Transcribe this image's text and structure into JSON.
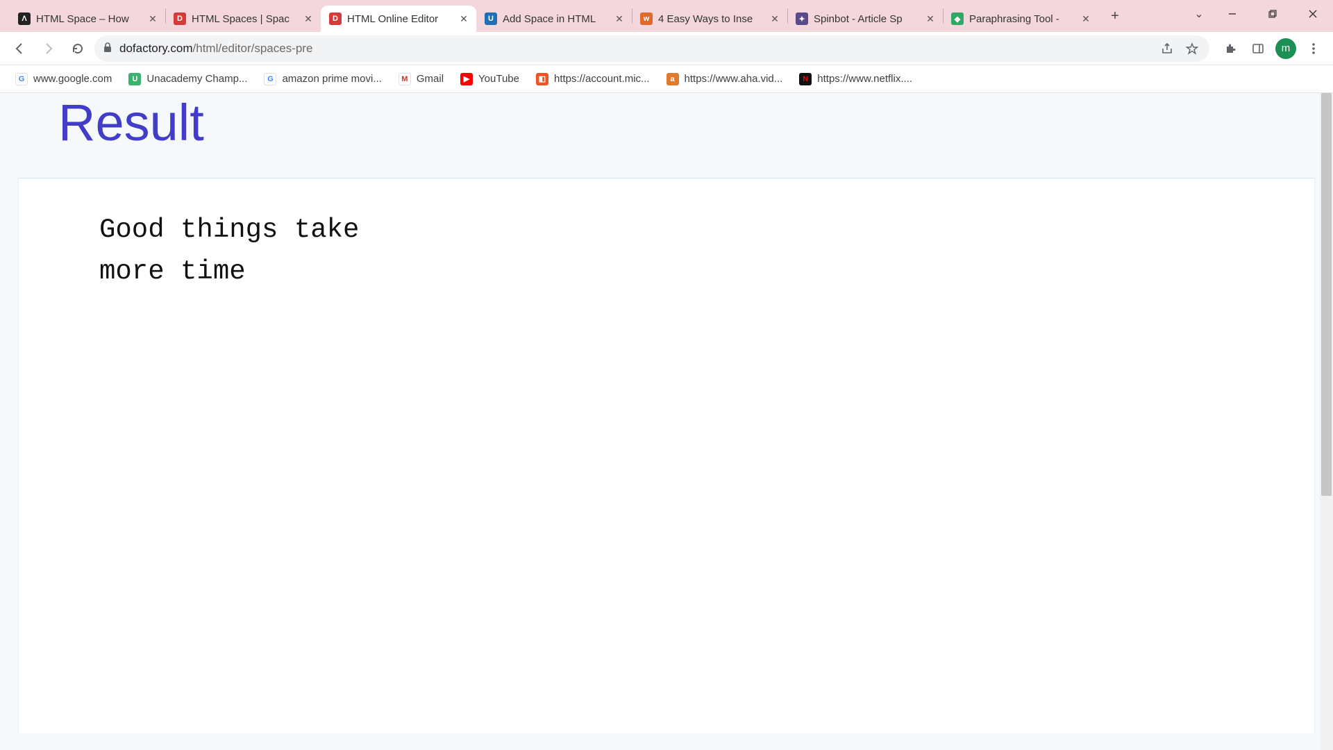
{
  "window": {
    "chevron": "⌄",
    "minimize": "—",
    "maximize": "❐",
    "close": "✕"
  },
  "tabs": [
    {
      "label": "HTML Space – How",
      "fav_bg": "#222222",
      "fav_text": "Λ"
    },
    {
      "label": "HTML Spaces | Spac",
      "fav_bg": "#d63b3b",
      "fav_text": "D"
    },
    {
      "label": "HTML Online Editor",
      "fav_bg": "#d63b3b",
      "fav_text": "D",
      "active": true
    },
    {
      "label": "Add Space in HTML",
      "fav_bg": "#1f6fb2",
      "fav_text": "U"
    },
    {
      "label": "4 Easy Ways to Inse",
      "fav_bg": "#e06a2b",
      "fav_text": "w"
    },
    {
      "label": "Spinbot - Article Sp",
      "fav_bg": "#5a4a8a",
      "fav_text": "✦"
    },
    {
      "label": "Paraphrasing Tool -",
      "fav_bg": "#2fa866",
      "fav_text": "◆"
    }
  ],
  "newtab": "+",
  "address": {
    "lock": "🔒",
    "host": "dofactory.com",
    "path": "/html/editor/spaces-pre"
  },
  "toolbar_right": {
    "avatar_letter": "m"
  },
  "bookmarks": [
    {
      "label": "www.google.com",
      "fav_bg": "#ffffff",
      "fav_text": "G",
      "fav_color": "#4285F4"
    },
    {
      "label": "Unacademy Champ...",
      "fav_bg": "#3ab16c",
      "fav_text": "U"
    },
    {
      "label": "amazon prime movi...",
      "fav_bg": "#ffffff",
      "fav_text": "G",
      "fav_color": "#4285F4"
    },
    {
      "label": "Gmail",
      "fav_bg": "#ffffff",
      "fav_text": "✉",
      "fav_color": "#d93025"
    },
    {
      "label": "YouTube",
      "fav_bg": "#ff0000",
      "fav_text": "▶"
    },
    {
      "label": "https://account.mic...",
      "fav_bg": "#f35426",
      "fav_text": "◧"
    },
    {
      "label": "https://www.aha.vid...",
      "fav_bg": "#e07a2d",
      "fav_text": "a"
    },
    {
      "label": "https://www.netflix....",
      "fav_bg": "#111111",
      "fav_text": "N",
      "fav_color": "#e50914"
    }
  ],
  "page": {
    "heading": "Result",
    "pre_text": "Good things take\nmore time"
  }
}
